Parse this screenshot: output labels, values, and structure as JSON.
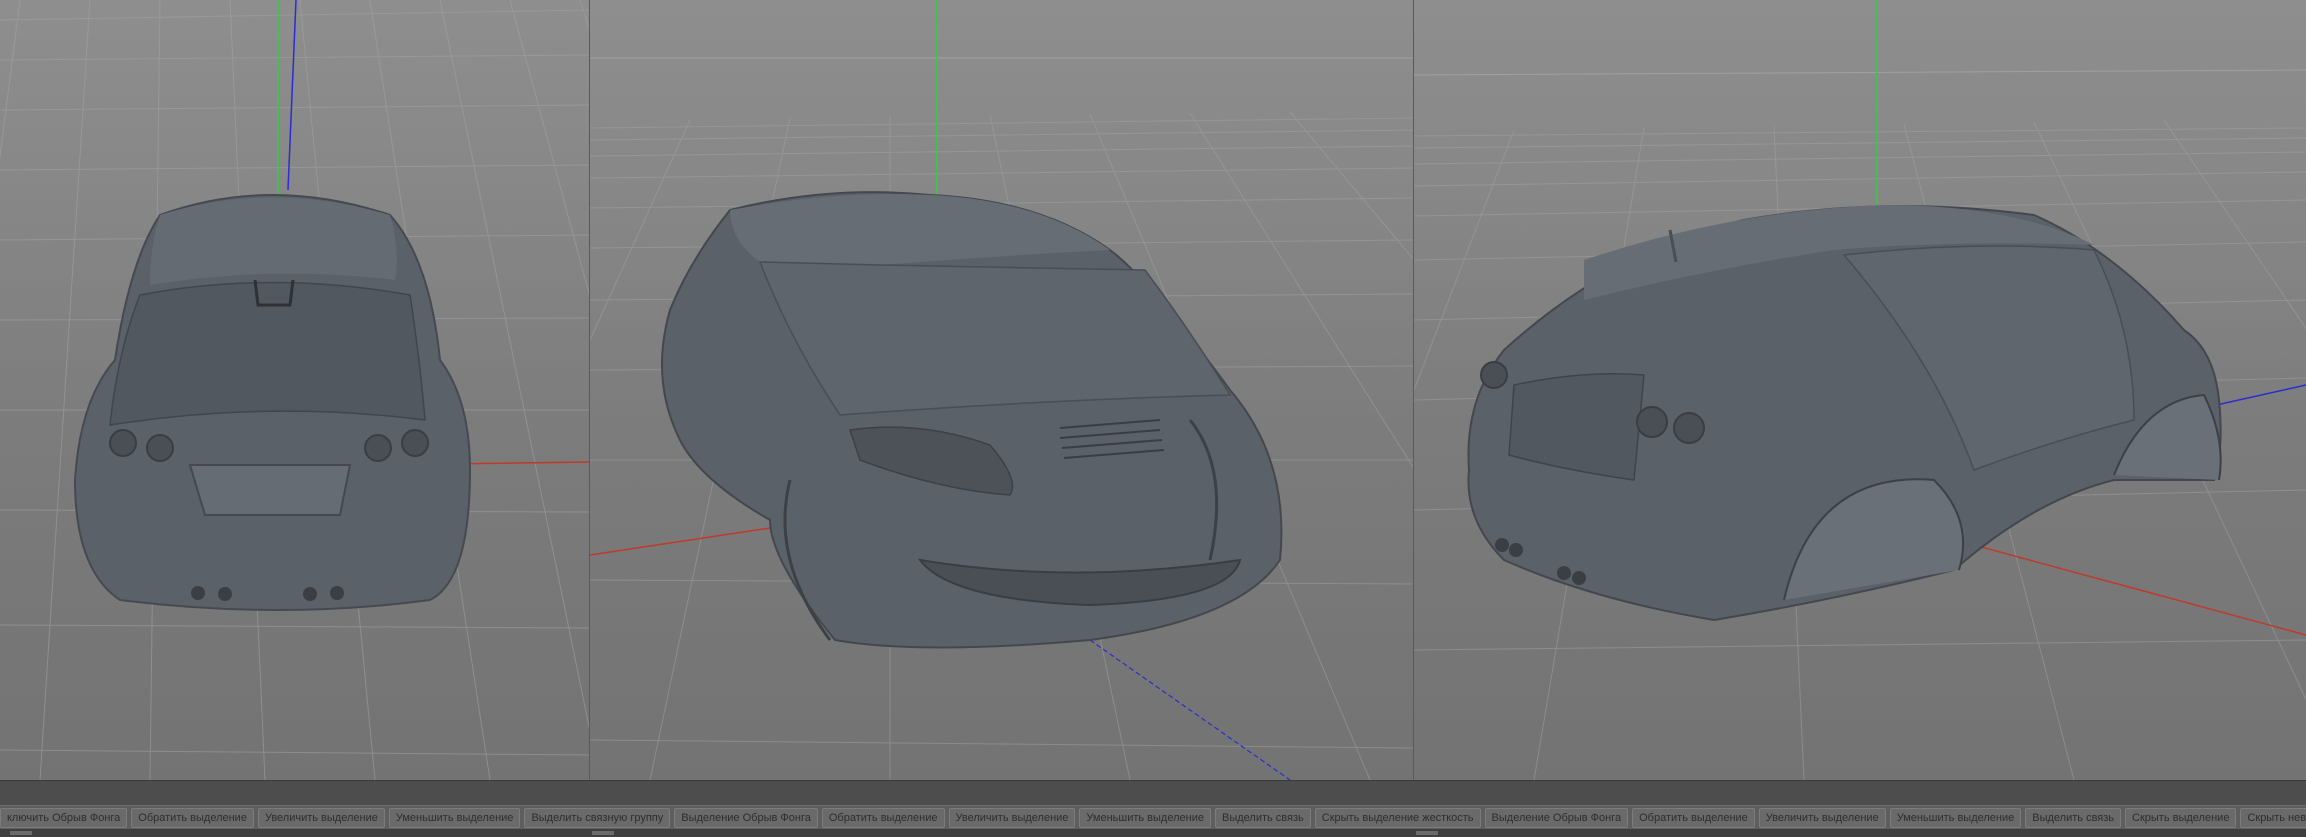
{
  "app": {
    "name": "3D viewport editor",
    "colors": {
      "background": "#7c7c7c",
      "grid": "#9a9a9a",
      "axis_x": "#c0392b",
      "axis_y": "#2ecc40",
      "axis_z": "#2c2cd0",
      "model": "#5a6068",
      "statusbar": "#4d4d4d"
    }
  },
  "viewports": [
    {
      "id": "left",
      "view": "rear"
    },
    {
      "id": "center",
      "view": "front-three-quarter"
    },
    {
      "id": "right",
      "view": "rear-three-quarter"
    }
  ],
  "command_bar": {
    "buttons": [
      "ключить Обрыв Фонга",
      "Обратить выделение",
      "Увеличить выделение",
      "Уменьшить выделение",
      "Выделить связную группу",
      "Выделение Обрыв Фонга",
      "Обратить выделение",
      "Увеличить выделение",
      "Уменьшить выделение",
      "Выделить связь",
      "Скрыть выделение жесткость",
      "Выделение Обрыв Фонга",
      "Обратить выделение",
      "Увеличить выделение",
      "Уменьшить выделение",
      "Выделить связь",
      "Скрыть выделение",
      "Скрыть нев"
    ]
  }
}
